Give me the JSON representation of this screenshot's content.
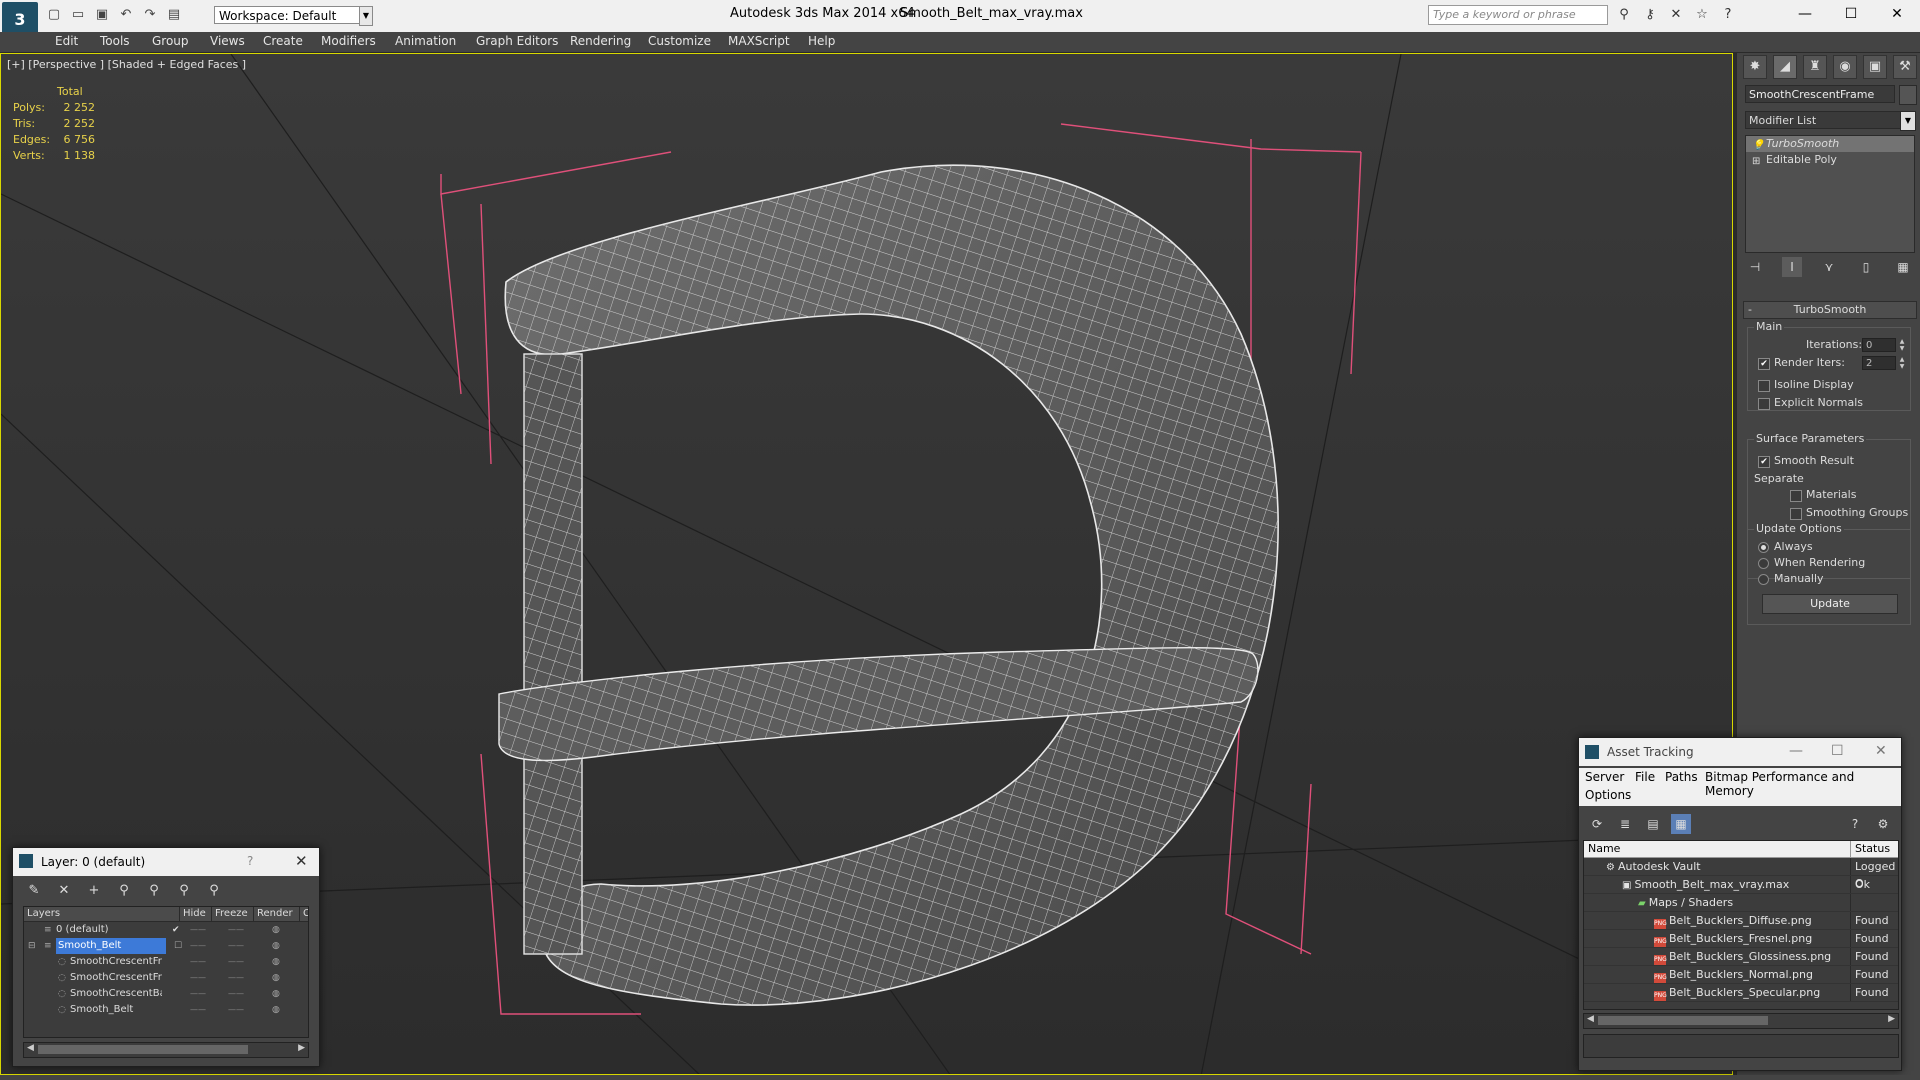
{
  "titlebar": {
    "app_title": "Autodesk 3ds Max  2014 x64",
    "file_title": "Smooth_Belt_max_vray.max",
    "workspace": "Workspace: Default",
    "search_placeholder": "Type a keyword or phrase"
  },
  "menu": [
    "Edit",
    "Tools",
    "Group",
    "Views",
    "Create",
    "Modifiers",
    "Animation",
    "Graph Editors",
    "Rendering",
    "Customize",
    "MAXScript",
    "Help"
  ],
  "viewport": {
    "label": "[+] [Perspective ] [Shaded + Edged Faces ]",
    "stats": {
      "header": "Total",
      "rows": [
        {
          "k": "Polys:",
          "v": "2 252"
        },
        {
          "k": "Tris:",
          "v": "2 252"
        },
        {
          "k": "Edges:",
          "v": "6 756"
        },
        {
          "k": "Verts:",
          "v": "1 138"
        }
      ]
    }
  },
  "command_panel": {
    "object_name": "SmoothCrescentFrame",
    "modifier_list": "Modifier List",
    "stack": [
      {
        "label": "TurboSmooth",
        "selected": true
      },
      {
        "label": "Editable Poly",
        "selected": false
      }
    ],
    "rollout_title": "TurboSmooth",
    "main_group": "Main",
    "iterations_label": "Iterations:",
    "iterations_value": "0",
    "render_iters_label": "Render Iters:",
    "render_iters_value": "2",
    "isoline_label": "Isoline Display",
    "explicit_normals_label": "Explicit Normals",
    "surface_group": "Surface Parameters",
    "smooth_result_label": "Smooth Result",
    "separate_label": "Separate",
    "materials_label": "Materials",
    "smoothing_groups_label": "Smoothing Groups",
    "update_group": "Update Options",
    "always_label": "Always",
    "when_rendering_label": "When Rendering",
    "manually_label": "Manually",
    "update_button": "Update"
  },
  "layer_dialog": {
    "title": "Layer: 0 (default)",
    "help": "?",
    "columns": [
      "Layers",
      "Hide",
      "Freeze",
      "Render",
      "C"
    ],
    "rows": [
      {
        "name": "0 (default)",
        "indent": 0,
        "selected": false
      },
      {
        "name": "Smooth_Belt",
        "indent": 0,
        "selected": true
      },
      {
        "name": "SmoothCrescentFr",
        "indent": 1,
        "selected": false
      },
      {
        "name": "SmoothCrescentFr",
        "indent": 1,
        "selected": false
      },
      {
        "name": "SmoothCrescentBa",
        "indent": 1,
        "selected": false
      },
      {
        "name": "Smooth_Belt",
        "indent": 1,
        "selected": false
      }
    ]
  },
  "asset_tracking": {
    "title": "Asset Tracking",
    "menu": [
      "Server",
      "File",
      "Paths",
      "Bitmap Performance and Memory",
      "Options"
    ],
    "columns": [
      "Name",
      "Status"
    ],
    "rows": [
      {
        "name": "Autodesk Vault",
        "status": "Logged O",
        "indent": 0,
        "icon": "vault"
      },
      {
        "name": "Smooth_Belt_max_vray.max",
        "status": "Ok",
        "indent": 1,
        "icon": "max"
      },
      {
        "name": "Maps / Shaders",
        "status": "",
        "indent": 2,
        "icon": "maps"
      },
      {
        "name": "Belt_Bucklers_Diffuse.png",
        "status": "Found",
        "indent": 3,
        "icon": "png"
      },
      {
        "name": "Belt_Bucklers_Fresnel.png",
        "status": "Found",
        "indent": 3,
        "icon": "png"
      },
      {
        "name": "Belt_Bucklers_Glossiness.png",
        "status": "Found",
        "indent": 3,
        "icon": "png"
      },
      {
        "name": "Belt_Bucklers_Normal.png",
        "status": "Found",
        "indent": 3,
        "icon": "png"
      },
      {
        "name": "Belt_Bucklers_Specular.png",
        "status": "Found",
        "indent": 3,
        "icon": "png"
      }
    ]
  },
  "colors": {
    "viewport_border": "#d8d800",
    "stats_text": "#e8d24a",
    "selection": "#3d7ad8",
    "bbox_lines": "#e0507a",
    "mesh_fill": "#5a5a5a",
    "wire": "#cfcfcf"
  }
}
